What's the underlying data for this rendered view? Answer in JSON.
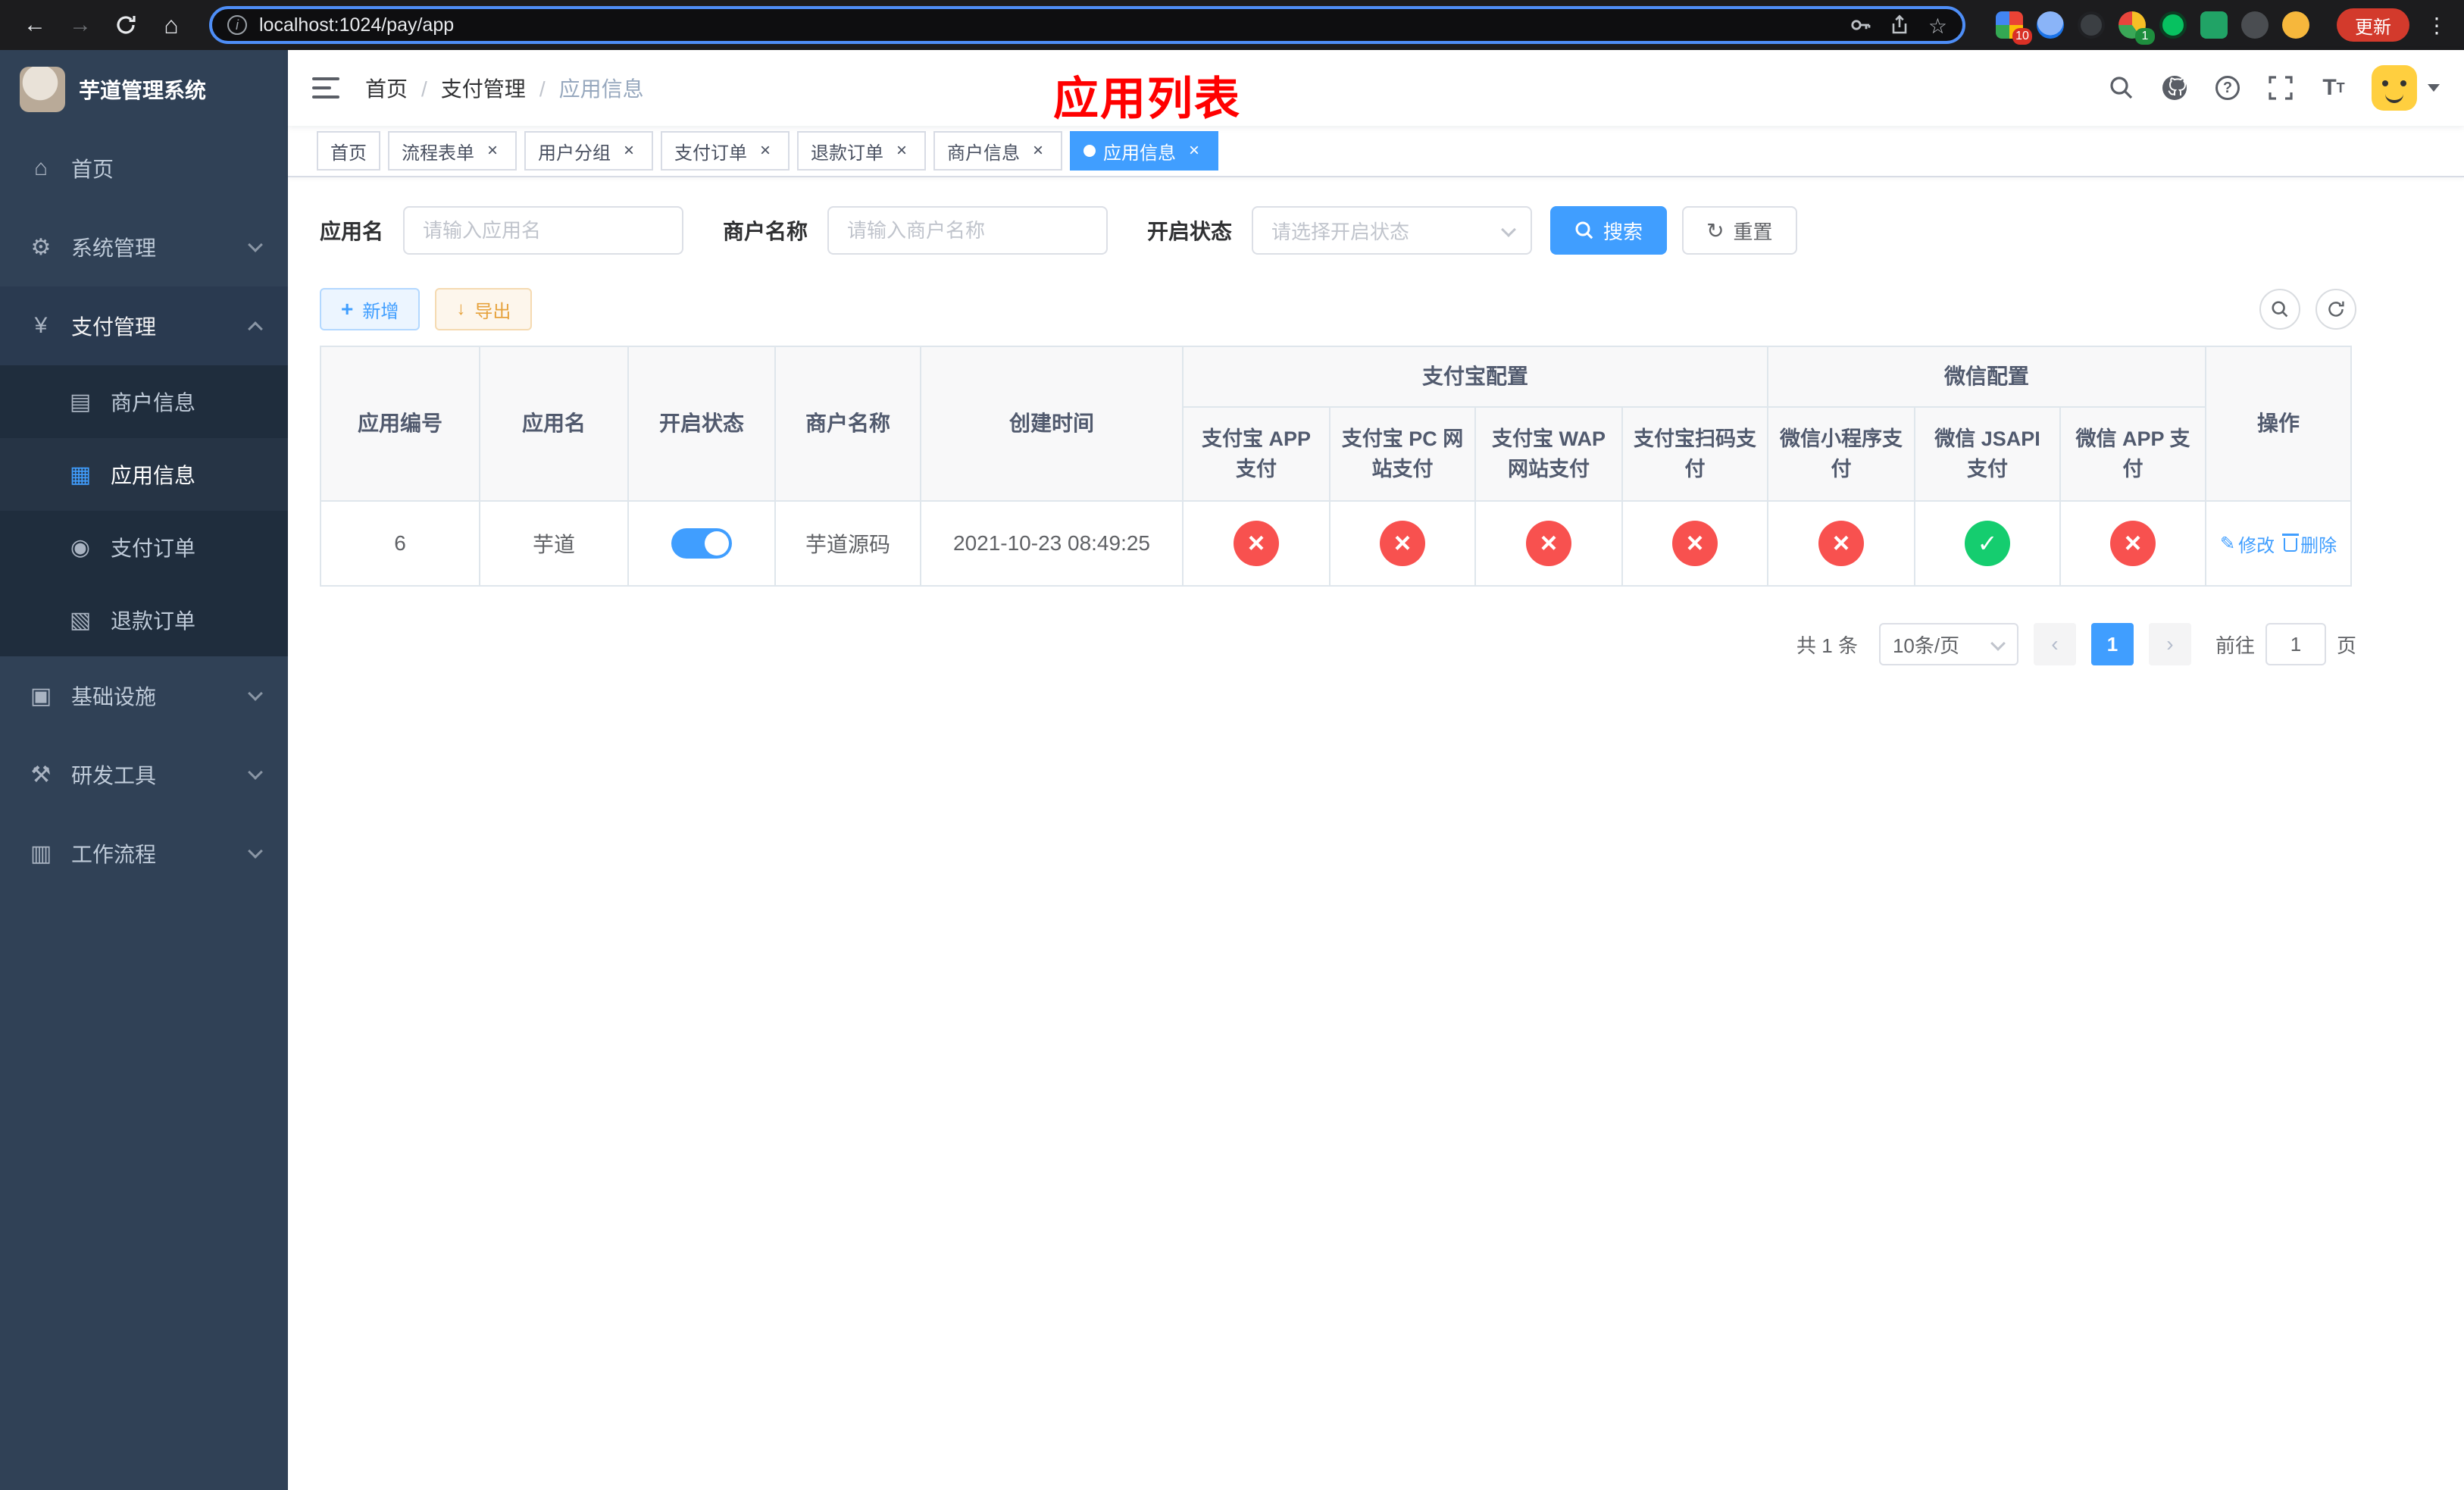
{
  "browser": {
    "url": "localhost:1024/pay/app",
    "update_label": "更新",
    "extension_badges": [
      "10",
      "1"
    ]
  },
  "sidebar": {
    "title": "芋道管理系统",
    "items": [
      {
        "label": "首页"
      },
      {
        "label": "系统管理"
      },
      {
        "label": "支付管理"
      },
      {
        "label": "基础设施"
      },
      {
        "label": "研发工具"
      },
      {
        "label": "工作流程"
      }
    ],
    "payment_children": [
      {
        "label": "商户信息"
      },
      {
        "label": "应用信息"
      },
      {
        "label": "支付订单"
      },
      {
        "label": "退款订单"
      }
    ]
  },
  "navbar": {
    "breadcrumb": [
      "首页",
      "支付管理",
      "应用信息"
    ],
    "overlay_title": "应用列表"
  },
  "tags": [
    {
      "label": "首页"
    },
    {
      "label": "流程表单"
    },
    {
      "label": "用户分组"
    },
    {
      "label": "支付订单"
    },
    {
      "label": "退款订单"
    },
    {
      "label": "商户信息"
    },
    {
      "label": "应用信息"
    }
  ],
  "filters": {
    "app_name_label": "应用名",
    "app_name_placeholder": "请输入应用名",
    "merchant_label": "商户名称",
    "merchant_placeholder": "请输入商户名称",
    "status_label": "开启状态",
    "status_placeholder": "请选择开启状态",
    "search_button": "搜索",
    "reset_button": "重置"
  },
  "toolbar": {
    "add_button": "新增",
    "export_button": "导出"
  },
  "table": {
    "main_columns": [
      "应用编号",
      "应用名",
      "开启状态",
      "商户名称",
      "创建时间"
    ],
    "group_columns": {
      "alipay": "支付宝配置",
      "wechat": "微信配置"
    },
    "sub_columns": [
      "支付宝 APP 支付",
      "支付宝 PC 网站支付",
      "支付宝 WAP 网站支付",
      "支付宝扫码支付",
      "微信小程序支付",
      "微信 JSAPI 支付",
      "微信 APP 支付"
    ],
    "action_column": "操作",
    "rows": [
      {
        "id": "6",
        "app_name": "芋道",
        "status_on": true,
        "merchant_name": "芋道源码",
        "create_time": "2021-10-23 08:49:25",
        "channels": [
          "no",
          "no",
          "no",
          "no",
          "no",
          "yes",
          "no"
        ],
        "edit_label": "修改",
        "delete_label": "删除"
      }
    ]
  },
  "pagination": {
    "total": "共 1 条",
    "page_size": "10条/页",
    "current_page": "1",
    "goto_label": "前往",
    "goto_value": "1",
    "goto_unit": "页"
  }
}
